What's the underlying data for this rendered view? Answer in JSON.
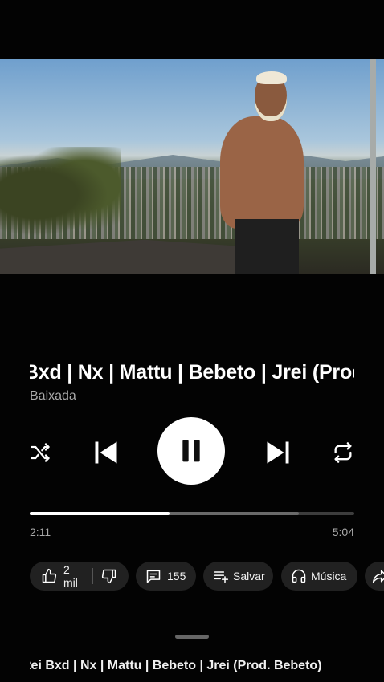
{
  "player": {
    "title": "Diamond | Rei Bxd | Nx | Mattu | Bebeto | Jrei (Prod. Bebeto)",
    "artist": "Baixada",
    "elapsed": "2:11",
    "duration": "5:04",
    "progress_fraction": 0.43,
    "buffered_fraction": 0.83
  },
  "actions": {
    "likes": "2 mil",
    "comments": "155",
    "save": "Salvar",
    "music": "Música"
  },
  "up_next": {
    "title": "Rei Bxd | Nx | Mattu | Bebeto | Jrei (Prod. Bebeto)"
  },
  "icons": [
    "shuffle-icon",
    "previous-icon",
    "pause-icon",
    "next-icon",
    "repeat-icon",
    "thumbs-up-icon",
    "thumbs-down-icon",
    "comment-icon",
    "playlist-add-icon",
    "headphones-icon",
    "share-icon"
  ]
}
